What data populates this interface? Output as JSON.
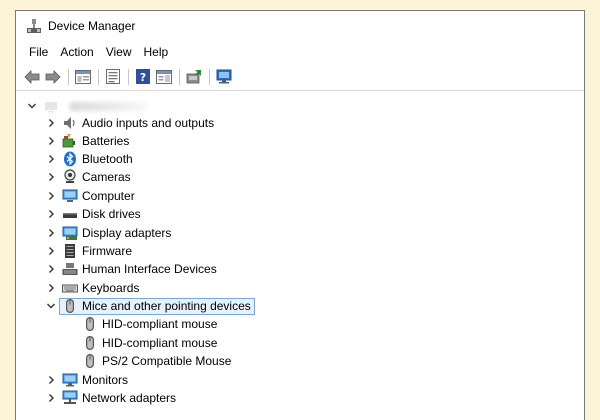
{
  "window": {
    "title": "Device Manager"
  },
  "menu": [
    "File",
    "Action",
    "View",
    "Help"
  ],
  "toolbar": {
    "buttons": [
      "back-icon",
      "forward-icon",
      "show-hide-tree-icon",
      "properties-icon",
      "help-icon",
      "action-pane-icon",
      "update-driver-icon",
      "scan-hardware-icon"
    ]
  },
  "tree": {
    "categories": [
      {
        "label": "Audio inputs and outputs",
        "icon": "speaker-icon"
      },
      {
        "label": "Batteries",
        "icon": "battery-icon"
      },
      {
        "label": "Bluetooth",
        "icon": "bluetooth-icon"
      },
      {
        "label": "Cameras",
        "icon": "camera-icon"
      },
      {
        "label": "Computer",
        "icon": "computer-icon"
      },
      {
        "label": "Disk drives",
        "icon": "disk-drive-icon"
      },
      {
        "label": "Display adapters",
        "icon": "display-adapter-icon"
      },
      {
        "label": "Firmware",
        "icon": "firmware-icon"
      },
      {
        "label": "Human Interface Devices",
        "icon": "hid-icon"
      },
      {
        "label": "Keyboards",
        "icon": "keyboard-icon"
      },
      {
        "label": "Mice and other pointing devices",
        "icon": "mouse-icon"
      },
      {
        "label": "Monitors",
        "icon": "monitor-icon"
      },
      {
        "label": "Network adapters",
        "icon": "network-adapter-icon"
      }
    ],
    "mice_children": [
      "HID-compliant mouse",
      "HID-compliant mouse",
      "PS/2 Compatible Mouse"
    ]
  },
  "colors": {
    "page_background": "#fdf3d9",
    "selection_fill": "#e5f1fb",
    "selection_border": "#7aa7d8"
  }
}
